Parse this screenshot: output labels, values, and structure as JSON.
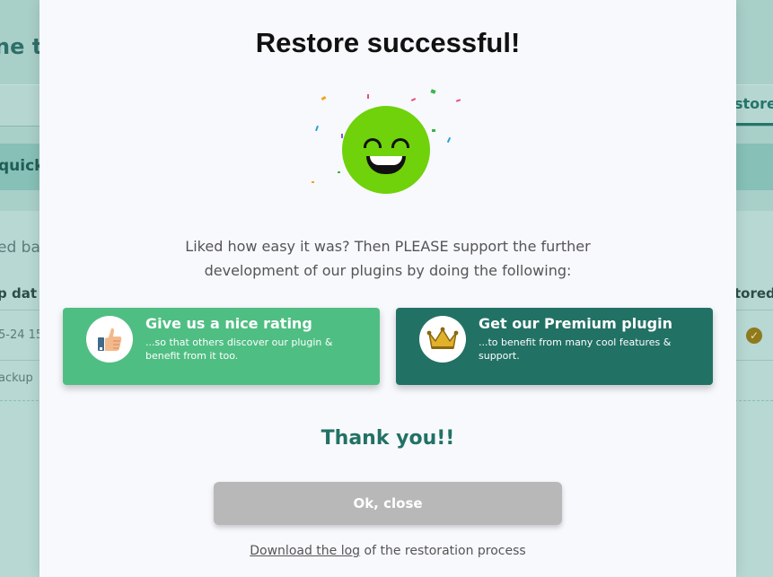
{
  "background": {
    "heading_fragment": "ne to",
    "tab_restore_fragment": "store",
    "quick_fragment": "quick",
    "based_fragment": "ed ba",
    "column_left_fragment": "p dat",
    "column_right_fragment": "tored",
    "row_date_fragment": "5-24 15",
    "backup_fragment": "ackup"
  },
  "modal": {
    "title": "Restore successful!",
    "description_line1": "Liked how easy it was? Then PLEASE support the further",
    "description_line2": "development of our plugins by doing the following:",
    "rating_card": {
      "title": "Give us a nice rating",
      "subtitle": "...so that others discover our plugin & benefit from it too.",
      "icon": "thumbs-up-icon"
    },
    "premium_card": {
      "title": "Get our Premium plugin",
      "subtitle": "...to benefit from many cool features & support.",
      "icon": "crown-icon"
    },
    "thanks": "Thank you!!",
    "ok_button": "Ok, close",
    "footer_link": "Download the log",
    "footer_text": " of the restoration process"
  },
  "colors": {
    "rating_green": "#4fbe83",
    "premium_teal": "#227165",
    "smiley_green": "#6fd20a",
    "ok_button_gray": "#b8b8b8"
  }
}
